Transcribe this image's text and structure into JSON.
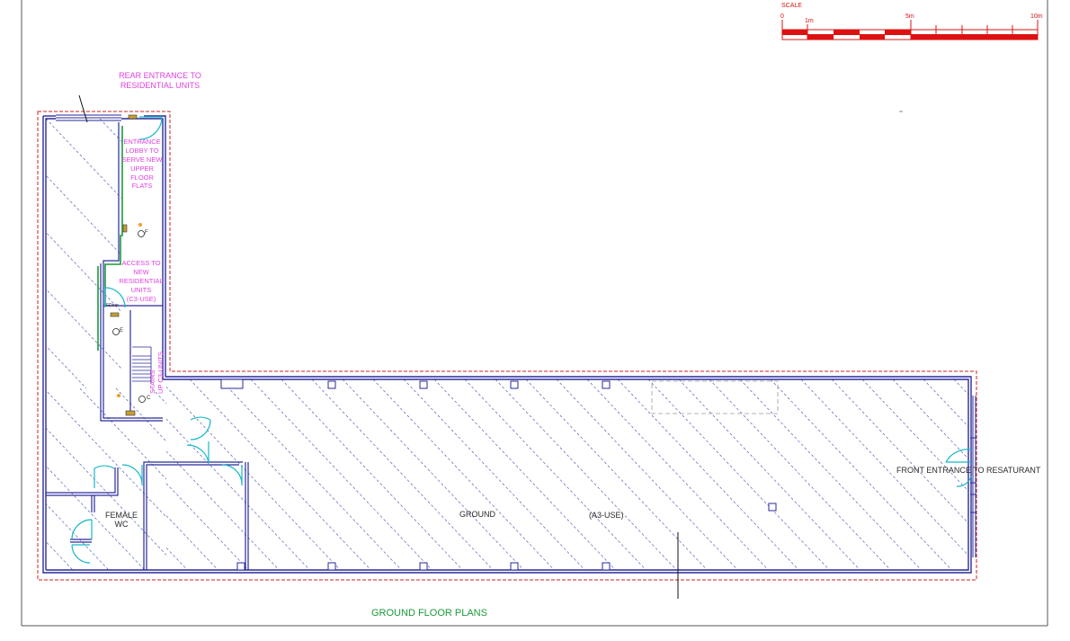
{
  "scale_bar": {
    "title": "SCALE",
    "ticks": [
      "0",
      "1m",
      "5m",
      "10m"
    ]
  },
  "labels": {
    "rear_entrance": [
      "REAR ENTRANCE TO",
      "RESIDENTIAL UNITS"
    ],
    "entrance_lobby": [
      "ENTRANCE",
      "LOBBY TO",
      "SERVE NEW",
      "UPPER",
      "FLOOR",
      "FLATS"
    ],
    "access_residential": [
      "ACCESS TO",
      "NEW",
      "RESIDENTIAL",
      "UNITS",
      "(C3-USE)"
    ],
    "stairs": [
      "STAIRS",
      "UP C3-UNITS"
    ],
    "female_wc": [
      "FEMALE",
      "WC"
    ],
    "ground": "GROUND",
    "a3_use": "(A3-USE)",
    "front_entrance": "FRONT ENTRANCE TO RESATURANT",
    "plan_title": "GROUND FLOOR PLANS",
    "fe_symbol_1": "F",
    "fe_symbol_2": "E",
    "fe_symbol_3": "C",
    "fe_tag": "FDoor"
  },
  "colors": {
    "wall": "#2a2a9a",
    "site_boundary": "#cc2222",
    "hatch": "#3a4ab0",
    "annotation": "#e040e0",
    "title": "#1a9a3a",
    "door_swing": "#18b8c8",
    "green_partition": "#1a9a3a",
    "scale_red": "#dd1111"
  }
}
